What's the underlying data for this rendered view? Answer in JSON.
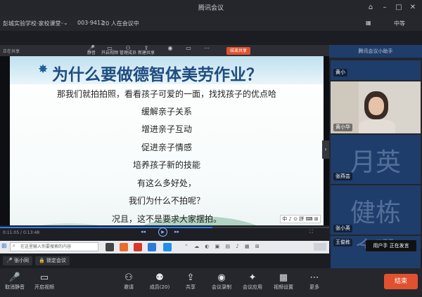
{
  "window": {
    "title": "腾讯会议"
  },
  "infobar": {
    "meeting_name": "彭城实验学校·家校课堂·德智体美劳主题会议",
    "meeting_id": "003·9412",
    "participants": "20 人在会议中",
    "right_label": "中等"
  },
  "share_toolbar": {
    "left_label": "正在共享",
    "items": [
      "静音",
      "开启视频",
      "管理成员",
      "新建共享",
      "结束共享"
    ],
    "stop_label": "结束共享"
  },
  "slide": {
    "heading": "为什么要做德智体美劳作业？",
    "lines": [
      "那我们就拍拍照，看看孩子可爱的一面，找找孩子的优点哈",
      "缓解亲子关系",
      "增进亲子互动",
      "促进亲子情感",
      "培养孩子新的技能",
      "有这么多好处，",
      "我们为什么不拍呢？",
      "况且，这不是要求大家摆拍。"
    ],
    "watermark": "中 ♪ ⊙ 拼 ⌨ ⊞"
  },
  "seek": {
    "time_left": "0:11:05 / 0:13:48"
  },
  "taskbar": {
    "search_placeholder": "在这里输入你要搜索的内容"
  },
  "bottom_left": {
    "mic_label": "张小同",
    "lock_label": "锁定会议"
  },
  "right_panel": {
    "top_label": "腾讯会议小助手",
    "tiles": [
      {
        "name": "黄小",
        "big_text": ""
      },
      {
        "name": "黄小华",
        "big_text": ""
      },
      {
        "name": "张燕芸",
        "big_text": "月英"
      },
      {
        "name": "张小英",
        "big_text": "健栋"
      },
      {
        "name": "王俊栋",
        "big_text": "金珊"
      }
    ],
    "popup": "用户手 正在发言"
  },
  "bottom_bar": {
    "items": [
      {
        "label": "取消静音",
        "icon": "mic-icon"
      },
      {
        "label": "开启视频",
        "icon": "camera-icon"
      },
      {
        "label": "邀请",
        "icon": "invite-icon"
      },
      {
        "label": "成员(20)",
        "icon": "members-icon"
      },
      {
        "label": "共享",
        "icon": "share-icon"
      },
      {
        "label": "会议录制",
        "icon": "record-icon"
      },
      {
        "label": "会议应用",
        "icon": "apps-icon"
      },
      {
        "label": "视频设置",
        "icon": "layout-icon"
      },
      {
        "label": "更多",
        "icon": "more-icon"
      }
    ],
    "end_label": "结束"
  },
  "colors": {
    "end_button": "#e0512f",
    "slide_heading": "#1e4d80",
    "tile_bg": "#1f3d6b",
    "accent_blue": "#2d7df6"
  }
}
